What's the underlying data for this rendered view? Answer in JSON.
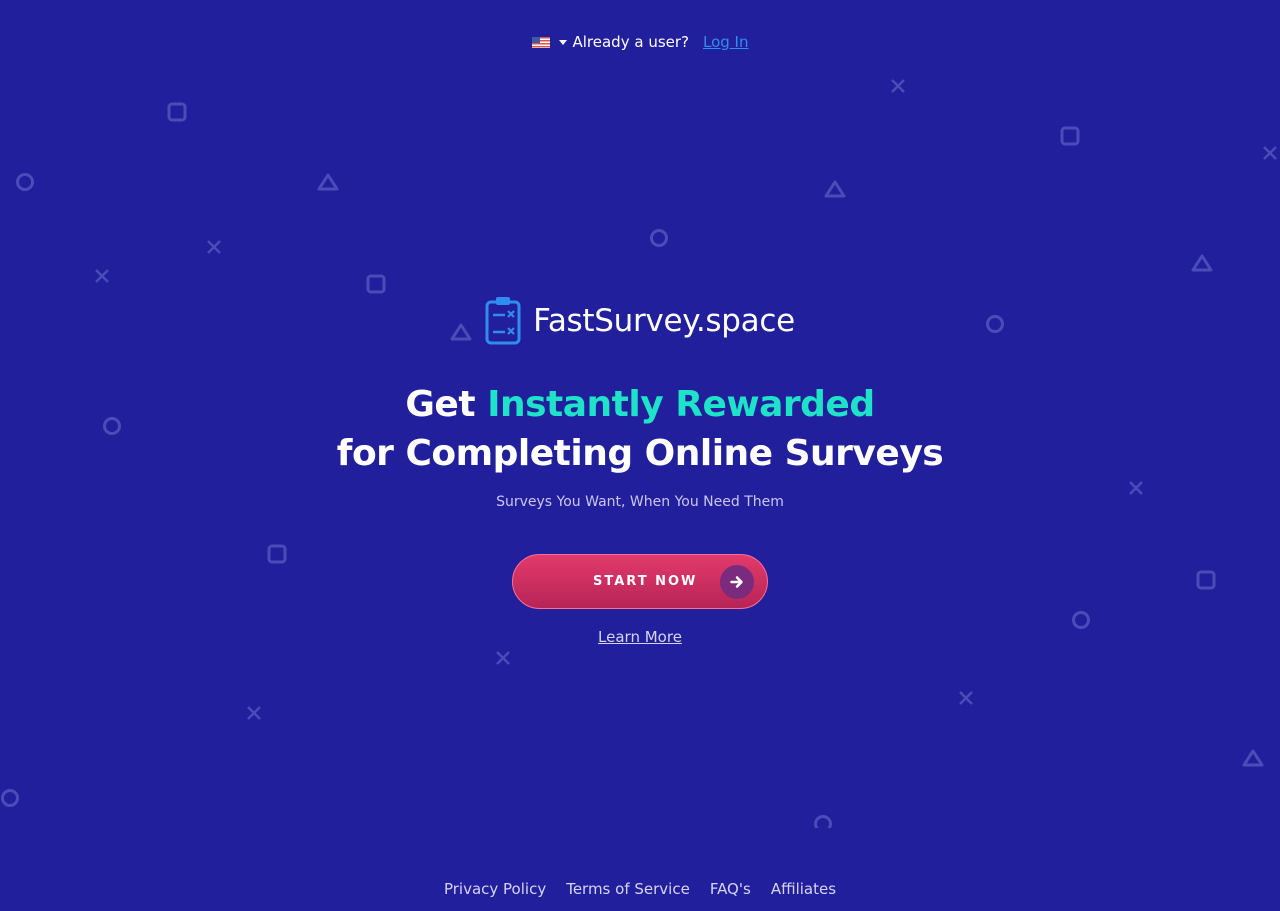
{
  "topbar": {
    "language_icon": "us-flag-icon",
    "already_user_text": "Already a user?",
    "login_label": "Log In"
  },
  "brand": {
    "name": "FastSurvey.space",
    "icon": "clipboard-icon"
  },
  "hero": {
    "headline_part1": "Get ",
    "headline_accent": "Instantly Rewarded",
    "headline_line2": "for Completing Online Surveys",
    "subtitle": "Surveys You Want, When You Need Them",
    "cta_label": "START NOW",
    "cta_icon": "arrow-right-icon",
    "learn_more_label": "Learn More"
  },
  "footer": {
    "links": [
      "Privacy Policy",
      "Terms of Service",
      "FAQ's",
      "Affiliates"
    ]
  },
  "colors": {
    "background": "#221f9c",
    "accent": "#1ee3c8",
    "cta": "#d12f62",
    "link": "#2f8cf0",
    "decoration": "#4a4cb8"
  }
}
